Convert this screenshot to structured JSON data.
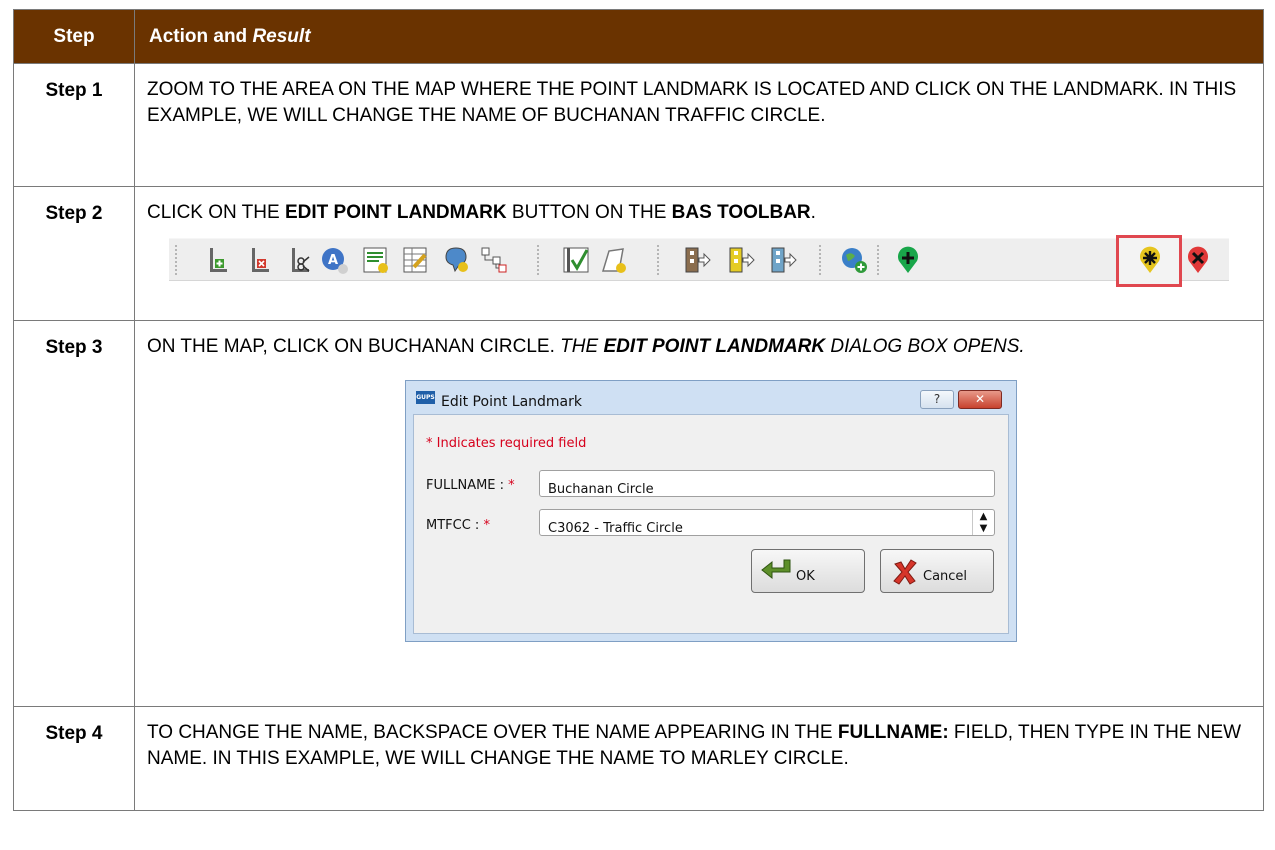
{
  "header": {
    "step": "Step",
    "action_prefix": "Action and ",
    "action_italic": "Result"
  },
  "rows": [
    {
      "step": "Step 1",
      "text": "ZOOM TO THE AREA ON THE MAP WHERE THE POINT LANDMARK IS LOCATED AND CLICK ON THE LANDMARK. IN THIS EXAMPLE, WE WILL CHANGE THE NAME OF BUCHANAN TRAFFIC CIRCLE."
    },
    {
      "step": "Step 2",
      "t1": "CLICK ON THE ",
      "b1": "EDIT POINT LANDMARK",
      "t2": " BUTTON ON THE ",
      "b2": "BAS TOOLBAR",
      "t3": "."
    },
    {
      "step": "Step 3",
      "t1": "ON THE MAP, CLICK ON BUCHANAN CIRCLE. ",
      "i1": "THE ",
      "ib": "EDIT POINT LANDMARK",
      "i2": " DIALOG BOX OPENS."
    },
    {
      "step": "Step 4",
      "t1": "TO CHANGE THE NAME, BACKSPACE OVER THE NAME APPEARING IN THE ",
      "b1": "FULLNAME:",
      "t2": " FIELD, THEN TYPE IN THE NEW NAME. IN THIS EXAMPLE, WE WILL CHANGE THE NAME TO MARLEY CIRCLE."
    }
  ],
  "toolbar": {
    "icons": [
      "add-linear-feature-icon",
      "delete-linear-feature-icon",
      "split-linear-feature-icon",
      "edit-attributes-icon",
      "edit-area-landmark-icon",
      "edit-attribute-table-icon",
      "edit-area-icon",
      "hierarchy-icon",
      "check-boundary-icon",
      "edit-polygon-icon",
      "export-left-icon",
      "export-yellow-icon",
      "export-blue-icon",
      "add-globe-icon",
      "add-point-landmark-icon",
      "edit-point-landmark-icon",
      "delete-point-landmark-icon"
    ]
  },
  "dialog": {
    "logo": "GUPS",
    "title": "Edit Point Landmark",
    "help": "?",
    "close": "✕",
    "required_note": "* Indicates required field",
    "fullname_label": "FULLNAME : ",
    "fullname_value": "Buchanan Circle",
    "mtfcc_label": "MTFCC : ",
    "mtfcc_value": "C3062 - Traffic Circle",
    "star": "*",
    "ok": "OK",
    "cancel": "Cancel"
  }
}
